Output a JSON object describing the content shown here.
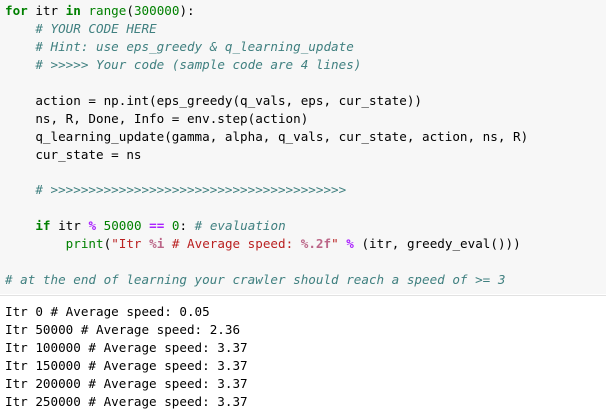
{
  "code": {
    "line1": {
      "kw_for": "for",
      "var": " itr ",
      "kw_in": "in",
      "sp": " ",
      "fn": "range",
      "p1": "(",
      "num": "300000",
      "p2": "):"
    },
    "line2": {
      "indent": "    ",
      "comment": "# YOUR CODE HERE"
    },
    "line3": {
      "indent": "    ",
      "comment": "# Hint: use eps_greedy & q_learning_update"
    },
    "line4": {
      "indent": "    ",
      "comment": "# >>>>> Your code (sample code are 4 lines)"
    },
    "line5": {
      "text": "    action = np.int(eps_greedy(q_vals, eps, cur_state))"
    },
    "line6": {
      "text": "    ns, R, Done, Info = env.step(action)"
    },
    "line7": {
      "text": "    q_learning_update(gamma, alpha, q_vals, cur_state, action, ns, R)"
    },
    "line8": {
      "text": "    cur_state = ns"
    },
    "line9": {
      "indent": "    ",
      "comment": "# >>>>>>>>>>>>>>>>>>>>>>>>>>>>>>>>>>>>>>>"
    },
    "line10": {
      "indent": "    ",
      "kw_if": "if",
      "a": " itr ",
      "pct": "%",
      "b": " ",
      "num1": "50000",
      "c": " ",
      "eq": "==",
      "d": " ",
      "num2": "0",
      "e": ": ",
      "comment": "# evaluation"
    },
    "line11": {
      "indent": "        ",
      "fn": "print",
      "p1": "(",
      "str1": "\"Itr ",
      "fmt1": "%i",
      "str2": " # Average speed: ",
      "fmt2": "%.2f",
      "str3": "\"",
      "f": " ",
      "pct": "%",
      "g": " (itr, greedy_eval()))"
    },
    "line12": {
      "comment": "# at the end of learning your crawler should reach a speed of >= 3"
    }
  },
  "output": {
    "lines": [
      "Itr 0 # Average speed: 0.05",
      "Itr 50000 # Average speed: 2.36",
      "Itr 100000 # Average speed: 3.37",
      "Itr 150000 # Average speed: 3.37",
      "Itr 200000 # Average speed: 3.37",
      "Itr 250000 # Average speed: 3.37"
    ]
  }
}
